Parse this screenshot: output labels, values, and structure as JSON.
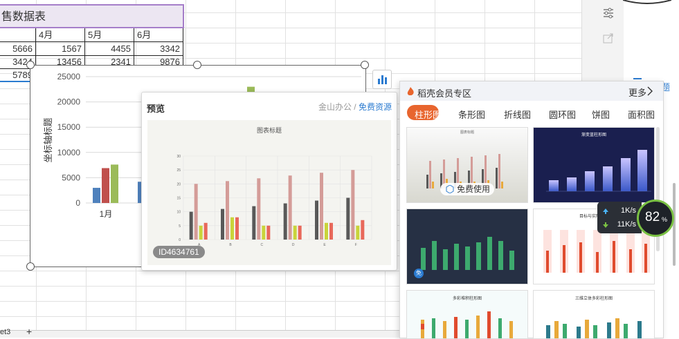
{
  "sheet": {
    "title": "售数据表",
    "headers": [
      "",
      "4月",
      "5月",
      "6月"
    ],
    "rows": [
      [
        "5666",
        "1567",
        "4455",
        "3342"
      ],
      [
        "3424",
        "13456",
        "2341",
        "9876"
      ],
      [
        "5789",
        "",
        "",
        ""
      ]
    ],
    "tab_fragment": "et3",
    "add_tab": "+"
  },
  "chart_data": {
    "type": "bar",
    "ylabel": "坐标轴标题",
    "ylim": [
      0,
      25000
    ],
    "yticks": [
      0,
      5000,
      10000,
      15000,
      20000,
      25000
    ],
    "categories": [
      "1月"
    ],
    "series": [
      {
        "values": [
          3000
        ],
        "color": "#4f81bd"
      },
      {
        "values": [
          6900
        ],
        "color": "#c0504d"
      },
      {
        "values": [
          7600
        ],
        "color": "#9bbb59"
      }
    ]
  },
  "preview": {
    "title": "预览",
    "source": "金山办公",
    "separator": "/",
    "free_link": "免费资源",
    "chart_title": "图表标题",
    "categories": [
      "A",
      "B",
      "C",
      "D",
      "E",
      "F"
    ],
    "ylim": [
      0,
      30
    ],
    "yticks": [
      0,
      5,
      10,
      15,
      20,
      25,
      30
    ],
    "series": [
      {
        "values": [
          10,
          11,
          12,
          13,
          14,
          15
        ],
        "color": "#595959"
      },
      {
        "values": [
          20,
          21,
          22,
          23,
          24,
          25
        ],
        "color": "#d49c98"
      },
      {
        "values": [
          5,
          8,
          5,
          5,
          6,
          5
        ],
        "color": "#c9d43b"
      },
      {
        "values": [
          6,
          8,
          5,
          5,
          6,
          7
        ],
        "color": "#e8685a"
      }
    ],
    "id_tag": "ID4634761"
  },
  "gallery": {
    "header": "稻壳会员专区",
    "more": "更多",
    "tabs": [
      "柱形图",
      "条形图",
      "折线图",
      "圆环图",
      "饼图",
      "面积图"
    ],
    "active_tab": 0,
    "free_use": "免费使用",
    "free_badge": "免",
    "thumb_titles": [
      "图表标题",
      "渐变蓝柱形图",
      "",
      "目标与实际完成",
      "多彩堆积柱形图",
      "三维立体多彩柱形图"
    ]
  },
  "speed": {
    "up": "1K/s",
    "down": "11K/s",
    "percent": "82",
    "unit": "%"
  },
  "side_text": "题",
  "colors": {
    "accent": "#e8652e",
    "link": "#2b7bd0",
    "gauge": "#7ac143"
  }
}
